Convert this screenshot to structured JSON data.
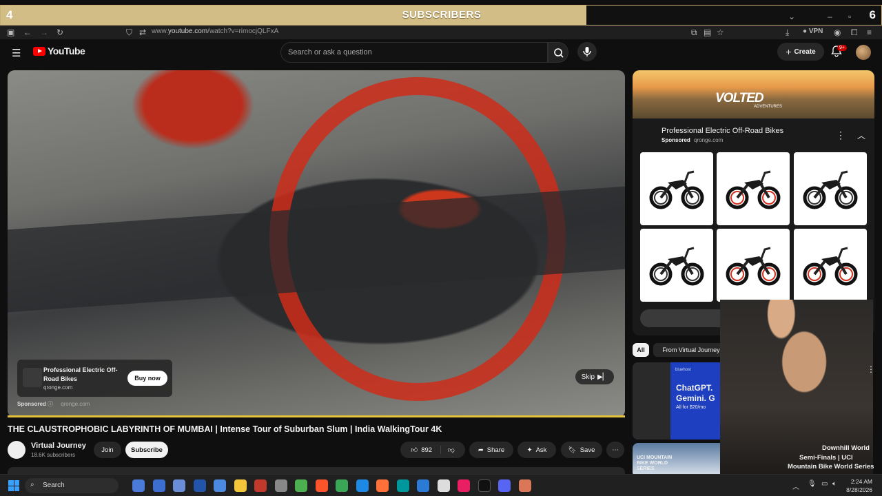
{
  "overlay": {
    "left_count": "4",
    "right_count": "6",
    "title": "SUBSCRIBERS"
  },
  "browser": {
    "url_prefix": "www.",
    "url_host": "youtube.com",
    "url_path": "/watch?v=rimocjQLFxA",
    "vpn_label": "VPN"
  },
  "header": {
    "logo_text": "YouTube",
    "search_placeholder": "Search or ask a question",
    "create_label": "Create",
    "notif_badge": "9+"
  },
  "video": {
    "ad_title": "Professional Electric Off-Road Bikes",
    "ad_url": "qronge.com",
    "buy_label": "Buy now",
    "sponsored_label": "Sponsored",
    "sponsored_url": "qronge.com",
    "skip_label": "Skip",
    "title": "THE CLAUSTROPHOBIC LABYRINTH OF MUMBAI | Intense Tour of Suburban Slum | India WalkingTour 4K"
  },
  "channel": {
    "name": "Virtual Journey",
    "subs": "18.6K subscribers",
    "join_label": "Join",
    "subscribe_label": "Subscribe"
  },
  "actions": {
    "likes": "892",
    "share_label": "Share",
    "ask_label": "Ask",
    "save_label": "Save"
  },
  "ad_panel": {
    "brand": "VOLTED",
    "brand_sub": "ADVENTURES",
    "title": "Professional Electric Off-Road Bikes",
    "sponsored": "Sponsored",
    "url": "qronge.com",
    "tiles": [
      "black",
      "red",
      "black",
      "black",
      "red",
      "red"
    ]
  },
  "chips": {
    "all": "All",
    "from_channel": "From Virtual Journey"
  },
  "recs": {
    "r1_badge": "bluehost",
    "r1_line1": "ChatGPT.",
    "r1_line2": "Gemini. G",
    "r1_line3": "All for $20/mo",
    "r2_thumb_label": "UCI MOUNTAIN BIKE WORLD SERIES",
    "r2_title_l1": "Downhill World",
    "r2_title_l2": "Semi-Finals | UCI",
    "r2_title_l3": "Mountain Bike World Series"
  },
  "taskbar": {
    "search_label": "Search",
    "time": "2:24 AM",
    "date": "8/28/2026"
  },
  "colors": {
    "accent": "#ff0000",
    "progress": "#e5c33a",
    "banner": "#d2bd86"
  }
}
